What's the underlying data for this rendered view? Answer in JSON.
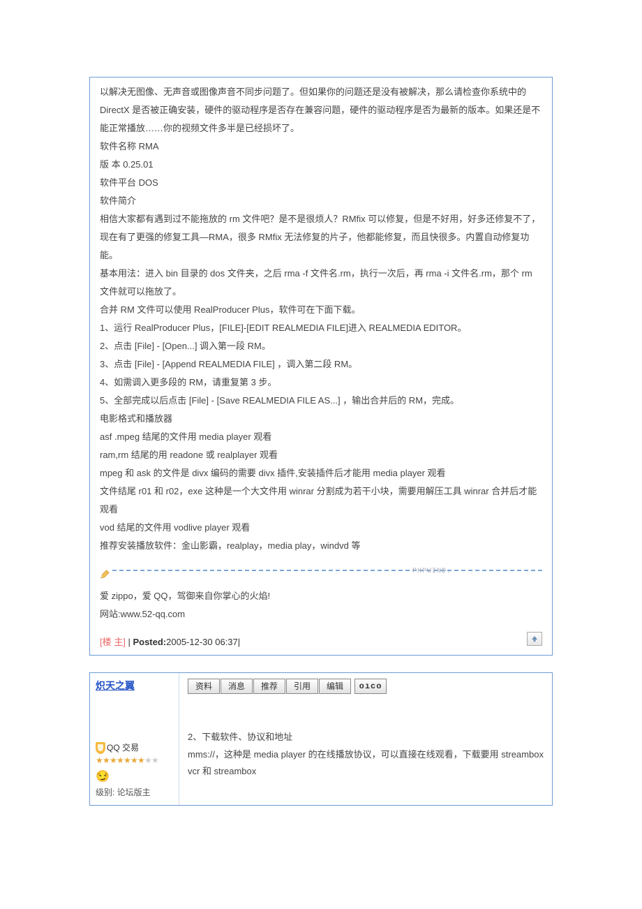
{
  "post": {
    "body": [
      "以解决无图像、无声音或图像声音不同步问题了。但如果你的问题还是没有被解决，那么请检查你系统中的 DirectX 是否被正确安装，硬件的驱动程序是否存在兼容问题，硬件的驱动程序是否为最新的版本。如果还是不能正常播放……你的视频文件多半是已经损坏了。",
      "软件名称 RMA",
      "版 本 0.25.01",
      "软件平台 DOS",
      "软件简介",
      "相信大家都有遇到过不能拖放的 rm 文件吧？是不是很烦人？RMfix 可以修复，但是不好用，好多还修复不了，现在有了更强的修复工具—RMA，很多 RMfix 无法修复的片子，他都能修复，而且快很多。内置自动修复功能。",
      "基本用法：进入 bin 目录的 dos 文件夹，之后 rma -f 文件名.rm，执行一次后，再 rma -i 文件名.rm，那个 rm 文件就可以拖放了。",
      "合并 RM 文件可以使用 RealProducer Plus，软件可在下面下载。",
      "1、运行 RealProducer Plus，[FILE]-[EDIT REALMEDIA FILE]进入 REALMEDIA EDITOR。",
      "2、点击 [File] - [Open...] 调入第一段 RM。",
      "3、点击 [File] - [Append REALMEDIA FILE] ，调入第二段 RM。",
      "4、如需调入更多段的 RM，请重复第 3 步。",
      "5、全部完成以后点击 [File] - [Save REALMEDIA FILE AS...] ，输出合并后的 RM，完成。",
      "电影格式和播放器",
      "asf .mpeg 结尾的文件用 media player 观看",
      "ram,rm 结尾的用 readone 或 realplayer 观看",
      "mpeg 和 ask 的文件是 divx 编码的需要 divx 插件,安装插件后才能用 media player 观看",
      "文件结尾 r01 和 r02，exe 这种是一个大文件用 winrar 分割成为若干小块，需要用解压工具 winrar 合并后才能观看",
      "vod 结尾的文件用 vodlive player 观看",
      "推荐安装播放软件：金山影霸，realplay，media play，windvd 等"
    ],
    "hr_brand": "PHPWIND.",
    "signature": [
      "爱 zippo，爱 QQ，驾御来自你掌心的火焰!",
      "",
      "网站:www.52-qq.com"
    ],
    "footer": {
      "floor": "[楼 主]",
      "sep": " | ",
      "posted_label": "Posted:",
      "posted_value": "2005-12-30 06:37|"
    }
  },
  "reply": {
    "username": "炽天之翼",
    "buttons": [
      "资料",
      "消息",
      "推荐",
      "引用",
      "编辑"
    ],
    "oico_label": "oıco",
    "user_title": "QQ 交易",
    "stars_filled": 7,
    "stars_total": 9,
    "face_emoji": "😏",
    "level_label": "级别: 论坛版主",
    "body": [
      "2、下载软件、协议和地址",
      "mms://，这种是 media player 的在线播放协议，可以直接在线观看，下载要用 streambox vcr 和 streambox"
    ]
  }
}
